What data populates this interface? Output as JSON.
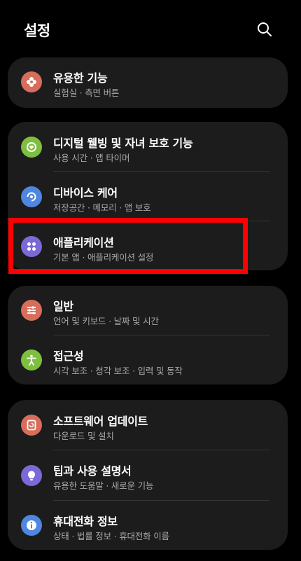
{
  "header": {
    "title": "설정"
  },
  "groups": [
    {
      "items": [
        {
          "label": "유용한 기능",
          "sub": "실험실  ·  측면 버튼",
          "icon": "flower-icon",
          "color": "#d86d5c"
        }
      ]
    },
    {
      "items": [
        {
          "label": "디지털 웰빙 및 자녀 보호 기능",
          "sub": "사용 시간  ·  앱 타이머",
          "icon": "wellbeing-icon",
          "color": "#7fbf3f"
        },
        {
          "label": "디바이스 케어",
          "sub": "저장공간  ·  메모리  ·  앱 보호",
          "icon": "device-care-icon",
          "color": "#4f86e0"
        },
        {
          "label": "애플리케이션",
          "sub": "기본 앱  ·  애플리케이션 설정",
          "icon": "apps-icon",
          "color": "#7a6ad8"
        }
      ]
    },
    {
      "items": [
        {
          "label": "일반",
          "sub": "언어 및 키보드  ·  날짜 및 시간",
          "icon": "sliders-icon",
          "color": "#d86d5c"
        },
        {
          "label": "접근성",
          "sub": "시각 보조  ·  청각 보조  ·  입력 및 동작",
          "icon": "accessibility-icon",
          "color": "#7fbf3f"
        }
      ]
    },
    {
      "items": [
        {
          "label": "소프트웨어 업데이트",
          "sub": "다운로드 및 설치",
          "icon": "update-icon",
          "color": "#d86d5c"
        },
        {
          "label": "팁과 사용 설명서",
          "sub": "유용한 도움말  ·  새로운 기능",
          "icon": "bulb-icon",
          "color": "#7a6ad8"
        },
        {
          "label": "휴대전화 정보",
          "sub": "상태  ·  법률 정보  ·  휴대전화 이름",
          "icon": "info-icon",
          "color": "#4f86e0"
        }
      ]
    }
  ]
}
